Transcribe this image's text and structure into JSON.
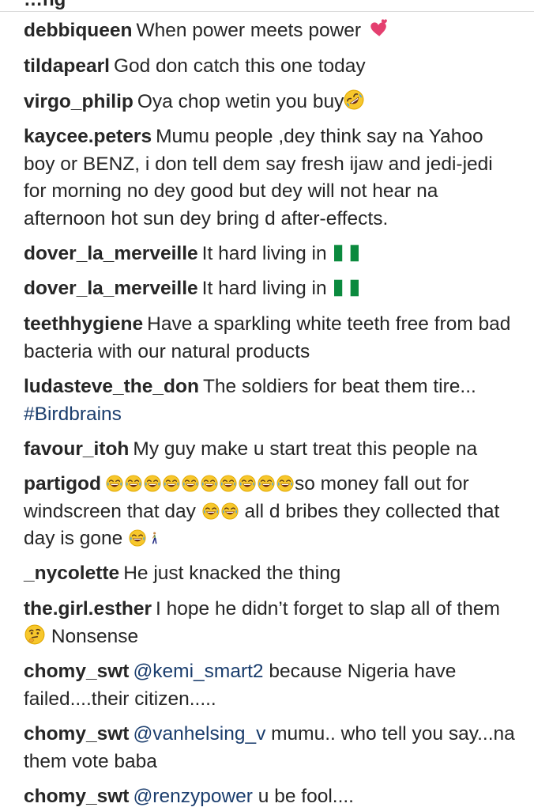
{
  "header": {
    "partial_title": "…ng"
  },
  "comments": [
    {
      "user": "debbiqueen",
      "text": "When power meets power",
      "emoji": "two-hearts-icon"
    },
    {
      "user": "tildapearl",
      "text": "God don catch this one today"
    },
    {
      "user": "virgo_philip",
      "text": "Oya chop wetin you buy",
      "emoji": "rofl-emoji-icon"
    },
    {
      "user": "kaycee.peters",
      "text": "Mumu people ,dey think say na Yahoo boy or BENZ, i don tell dem say fresh ijaw and jedi-jedi for morning no dey good but dey will not hear na afternoon hot sun dey bring d after-effects."
    },
    {
      "user": "dover_la_merveille",
      "text": "It hard living in",
      "emoji": "nigeria-flag-icon"
    },
    {
      "user": "dover_la_merveille",
      "text": "It hard living in",
      "emoji": "nigeria-flag-icon"
    },
    {
      "user": "teethhygiene",
      "text": "Have a sparkling white teeth free from bad bacteria with our natural products"
    },
    {
      "user": "ludasteve_the_don",
      "text": "The soldiers for beat them tire...",
      "hashtag": "#Birdbrains"
    },
    {
      "user": "favour_itoh",
      "text": "My guy make u start treat this people na"
    },
    {
      "user": "partigod",
      "text_1": "so money fall out for windscreen that day",
      "text_2": "all d bribes they collected that day is gone",
      "emoji": "tears-of-joy-emoji-icon",
      "emoji_2": "person-walking-icon"
    },
    {
      "user": "_nycolette",
      "text": "He just knacked the thing"
    },
    {
      "user": "the.girl.esther",
      "text_1": "I hope he didn’t forget to slap all of them",
      "text_2": "Nonsense",
      "emoji": "thinking-face-icon"
    },
    {
      "user": "chomy_swt",
      "mention": "@kemi_smart2",
      "text": "because Nigeria have failed....their citizen....."
    },
    {
      "user": "chomy_swt",
      "mention": "@vanhelsing_v",
      "text": "mumu.. who tell you say...na them vote baba"
    },
    {
      "user": "chomy_swt",
      "mention": "@renzypower",
      "text": "u be fool...."
    }
  ],
  "colors": {
    "text": "#262626",
    "link": "#1a3d6d",
    "divider": "#dbdbdb",
    "flag_green": "#0b8a3e"
  }
}
